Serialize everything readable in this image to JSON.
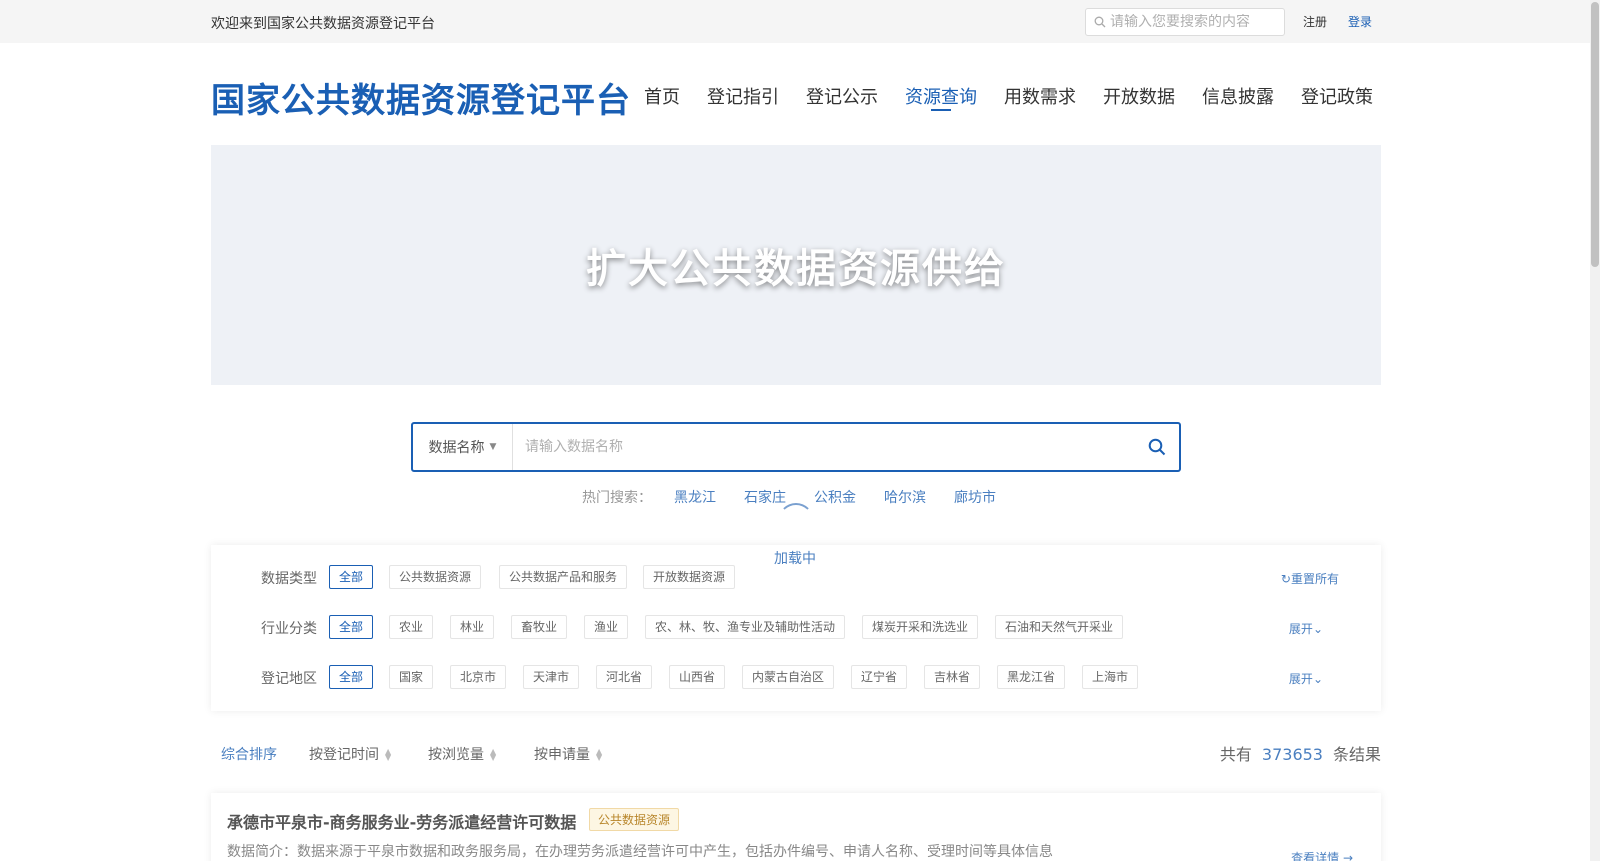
{
  "topbar": {
    "welcome": "欢迎来到国家公共数据资源登记平台",
    "search_placeholder": "请输入您要搜索的内容",
    "register": "注册",
    "login": "登录"
  },
  "logo": "国家公共数据资源登记平台",
  "nav": [
    "首页",
    "登记指引",
    "登记公示",
    "资源查询",
    "用数需求",
    "开放数据",
    "信息披露",
    "登记政策"
  ],
  "nav_active": "资源查询",
  "banner": {
    "text": "扩大公共数据资源供给"
  },
  "search": {
    "type_label": "数据名称",
    "placeholder": "请输入数据名称"
  },
  "hot": {
    "label": "热门搜索：",
    "tags": [
      "黑龙江",
      "石家庄",
      "公积金",
      "哈尔滨",
      "廊坊市"
    ]
  },
  "loading_text": "加载中",
  "filters": {
    "data_type": {
      "label": "数据类型",
      "tags": [
        "全部",
        "公共数据资源",
        "公共数据产品和服务",
        "开放数据资源"
      ],
      "action": "重置所有"
    },
    "industry": {
      "label": "行业分类",
      "tags": [
        "全部",
        "农业",
        "林业",
        "畜牧业",
        "渔业",
        "农、林、牧、渔专业及辅助性活动",
        "煤炭开采和洗选业",
        "石油和天然气开采业"
      ],
      "action": "展开"
    },
    "region": {
      "label": "登记地区",
      "tags": [
        "全部",
        "国家",
        "北京市",
        "天津市",
        "河北省",
        "山西省",
        "内蒙古自治区",
        "辽宁省",
        "吉林省",
        "黑龙江省",
        "上海市"
      ],
      "action": "展开"
    }
  },
  "sort": {
    "items": [
      "综合排序",
      "按登记时间",
      "按浏览量",
      "按申请量"
    ],
    "total_prefix": "共有",
    "total_count": "373653",
    "total_suffix": "条结果"
  },
  "results": [
    {
      "title": "承德市平泉市-商务服务业-劳务派遣经营许可数据",
      "badge": "公共数据资源",
      "desc": "数据简介：数据来源于平泉市数据和政务服务局，在办理劳务派遣经营许可中产生，包括办件编号、申请人名称、受理时间等具体信息",
      "detail": "查看详情"
    }
  ],
  "colors": {
    "primary": "#1a5fb4",
    "link": "#4a7fc0"
  }
}
